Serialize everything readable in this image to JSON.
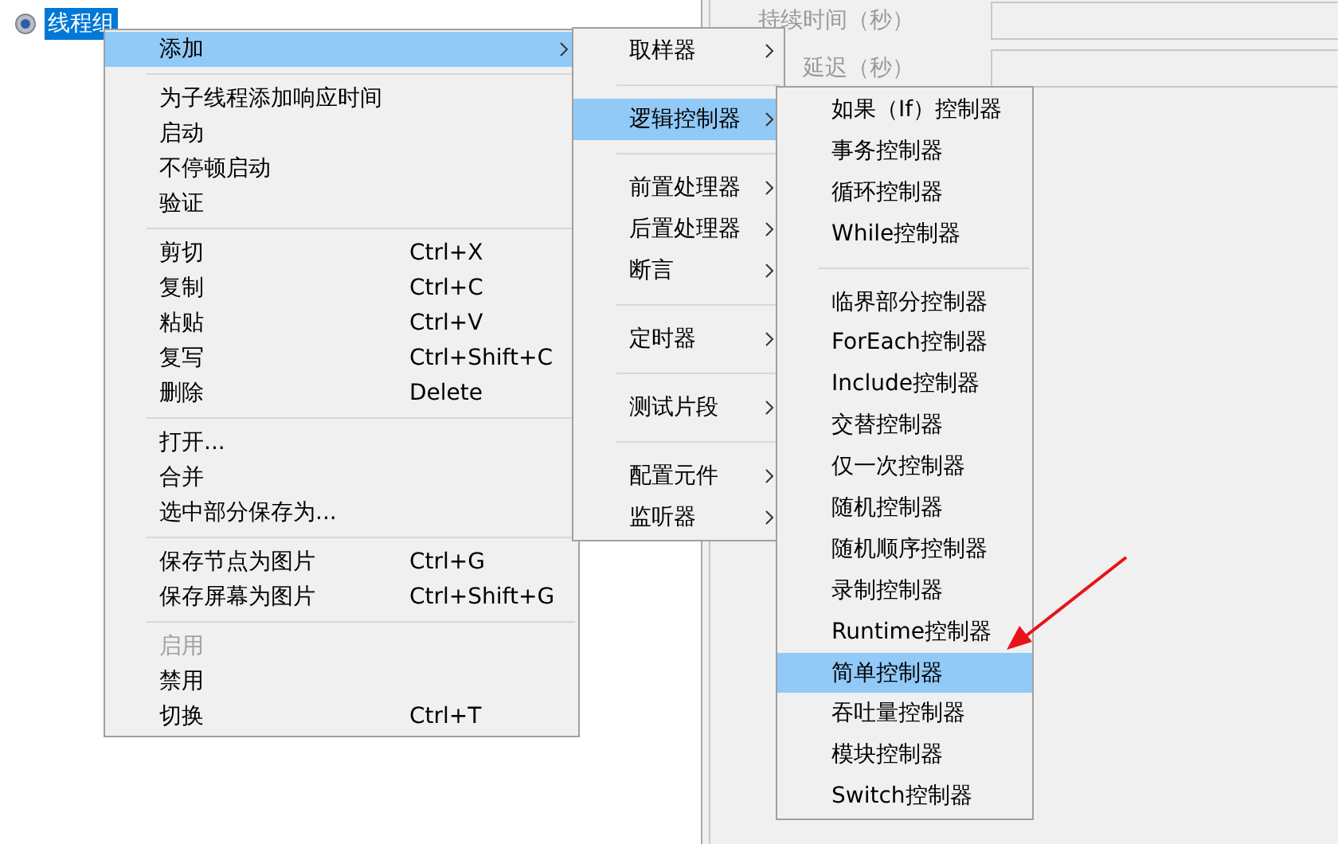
{
  "tree": {
    "node": {
      "label": "线程组",
      "selected": true
    }
  },
  "form": {
    "fields": [
      {
        "label": "持续时间（秒）"
      },
      {
        "label": "延迟（秒）"
      }
    ]
  },
  "context_menu": {
    "sections": [
      {
        "items": [
          {
            "label": "添加",
            "submenu": true,
            "selected": true,
            "disabled": false
          }
        ]
      },
      {
        "items": [
          {
            "label": "为子线程添加响应时间",
            "submenu": false,
            "selected": false,
            "disabled": false
          },
          {
            "label": "启动",
            "submenu": false,
            "selected": false,
            "disabled": false
          },
          {
            "label": "不停顿启动",
            "submenu": false,
            "selected": false,
            "disabled": false
          },
          {
            "label": "验证",
            "submenu": false,
            "selected": false,
            "disabled": false
          }
        ]
      },
      {
        "items": [
          {
            "label": "剪切",
            "shortcut": "Ctrl+X",
            "submenu": false,
            "selected": false,
            "disabled": false
          },
          {
            "label": "复制",
            "shortcut": "Ctrl+C",
            "submenu": false,
            "selected": false,
            "disabled": false
          },
          {
            "label": "粘贴",
            "shortcut": "Ctrl+V",
            "submenu": false,
            "selected": false,
            "disabled": false
          },
          {
            "label": "复写",
            "shortcut": "Ctrl+Shift+C",
            "submenu": false,
            "selected": false,
            "disabled": false
          },
          {
            "label": "删除",
            "shortcut": "Delete",
            "submenu": false,
            "selected": false,
            "disabled": false
          }
        ]
      },
      {
        "items": [
          {
            "label": "打开...",
            "submenu": false,
            "selected": false,
            "disabled": false
          },
          {
            "label": "合并",
            "submenu": false,
            "selected": false,
            "disabled": false
          },
          {
            "label": "选中部分保存为...",
            "submenu": false,
            "selected": false,
            "disabled": false
          }
        ]
      },
      {
        "items": [
          {
            "label": "保存节点为图片",
            "shortcut": "Ctrl+G",
            "submenu": false,
            "selected": false,
            "disabled": false
          },
          {
            "label": "保存屏幕为图片",
            "shortcut": "Ctrl+Shift+G",
            "submenu": false,
            "selected": false,
            "disabled": false
          }
        ]
      },
      {
        "items": [
          {
            "label": "启用",
            "submenu": false,
            "selected": false,
            "disabled": true
          },
          {
            "label": "禁用",
            "submenu": false,
            "selected": false,
            "disabled": false
          },
          {
            "label": "切换",
            "shortcut": "Ctrl+T",
            "submenu": false,
            "selected": false,
            "disabled": false
          }
        ]
      }
    ]
  },
  "add_menu": {
    "sections": [
      {
        "items": [
          {
            "label": "取样器",
            "submenu": true,
            "selected": false,
            "disabled": false
          }
        ]
      },
      {
        "items": [
          {
            "label": "逻辑控制器",
            "submenu": true,
            "selected": true,
            "disabled": false
          }
        ]
      },
      {
        "items": [
          {
            "label": "前置处理器",
            "submenu": true,
            "selected": false,
            "disabled": false
          },
          {
            "label": "后置处理器",
            "submenu": true,
            "selected": false,
            "disabled": false
          },
          {
            "label": "断言",
            "submenu": true,
            "selected": false,
            "disabled": false
          }
        ]
      },
      {
        "items": [
          {
            "label": "定时器",
            "submenu": true,
            "selected": false,
            "disabled": false
          }
        ]
      },
      {
        "items": [
          {
            "label": "测试片段",
            "submenu": true,
            "selected": false,
            "disabled": false
          }
        ]
      },
      {
        "items": [
          {
            "label": "配置元件",
            "submenu": true,
            "selected": false,
            "disabled": false
          },
          {
            "label": "监听器",
            "submenu": true,
            "selected": false,
            "disabled": false
          }
        ]
      }
    ]
  },
  "logic_menu": {
    "sections": [
      {
        "items": [
          {
            "label": "如果（If）控制器",
            "submenu": false,
            "selected": false,
            "disabled": false
          },
          {
            "label": "事务控制器",
            "submenu": false,
            "selected": false,
            "disabled": false
          },
          {
            "label": "循环控制器",
            "submenu": false,
            "selected": false,
            "disabled": false
          },
          {
            "label": "While控制器",
            "submenu": false,
            "selected": false,
            "disabled": false
          }
        ]
      },
      {
        "items": [
          {
            "label": "临界部分控制器",
            "submenu": false,
            "selected": false,
            "disabled": false
          },
          {
            "label": "ForEach控制器",
            "submenu": false,
            "selected": false,
            "disabled": false
          },
          {
            "label": "Include控制器",
            "submenu": false,
            "selected": false,
            "disabled": false
          },
          {
            "label": "交替控制器",
            "submenu": false,
            "selected": false,
            "disabled": false
          },
          {
            "label": "仅一次控制器",
            "submenu": false,
            "selected": false,
            "disabled": false
          },
          {
            "label": "随机控制器",
            "submenu": false,
            "selected": false,
            "disabled": false
          },
          {
            "label": "随机顺序控制器",
            "submenu": false,
            "selected": false,
            "disabled": false
          },
          {
            "label": "录制控制器",
            "submenu": false,
            "selected": false,
            "disabled": false
          },
          {
            "label": "Runtime控制器",
            "submenu": false,
            "selected": false,
            "disabled": false
          },
          {
            "label": "简单控制器",
            "submenu": false,
            "selected": true,
            "disabled": false
          },
          {
            "label": "吞吐量控制器",
            "submenu": false,
            "selected": false,
            "disabled": false
          },
          {
            "label": "模块控制器",
            "submenu": false,
            "selected": false,
            "disabled": false
          },
          {
            "label": "Switch控制器",
            "submenu": false,
            "selected": false,
            "disabled": false
          }
        ]
      }
    ]
  }
}
